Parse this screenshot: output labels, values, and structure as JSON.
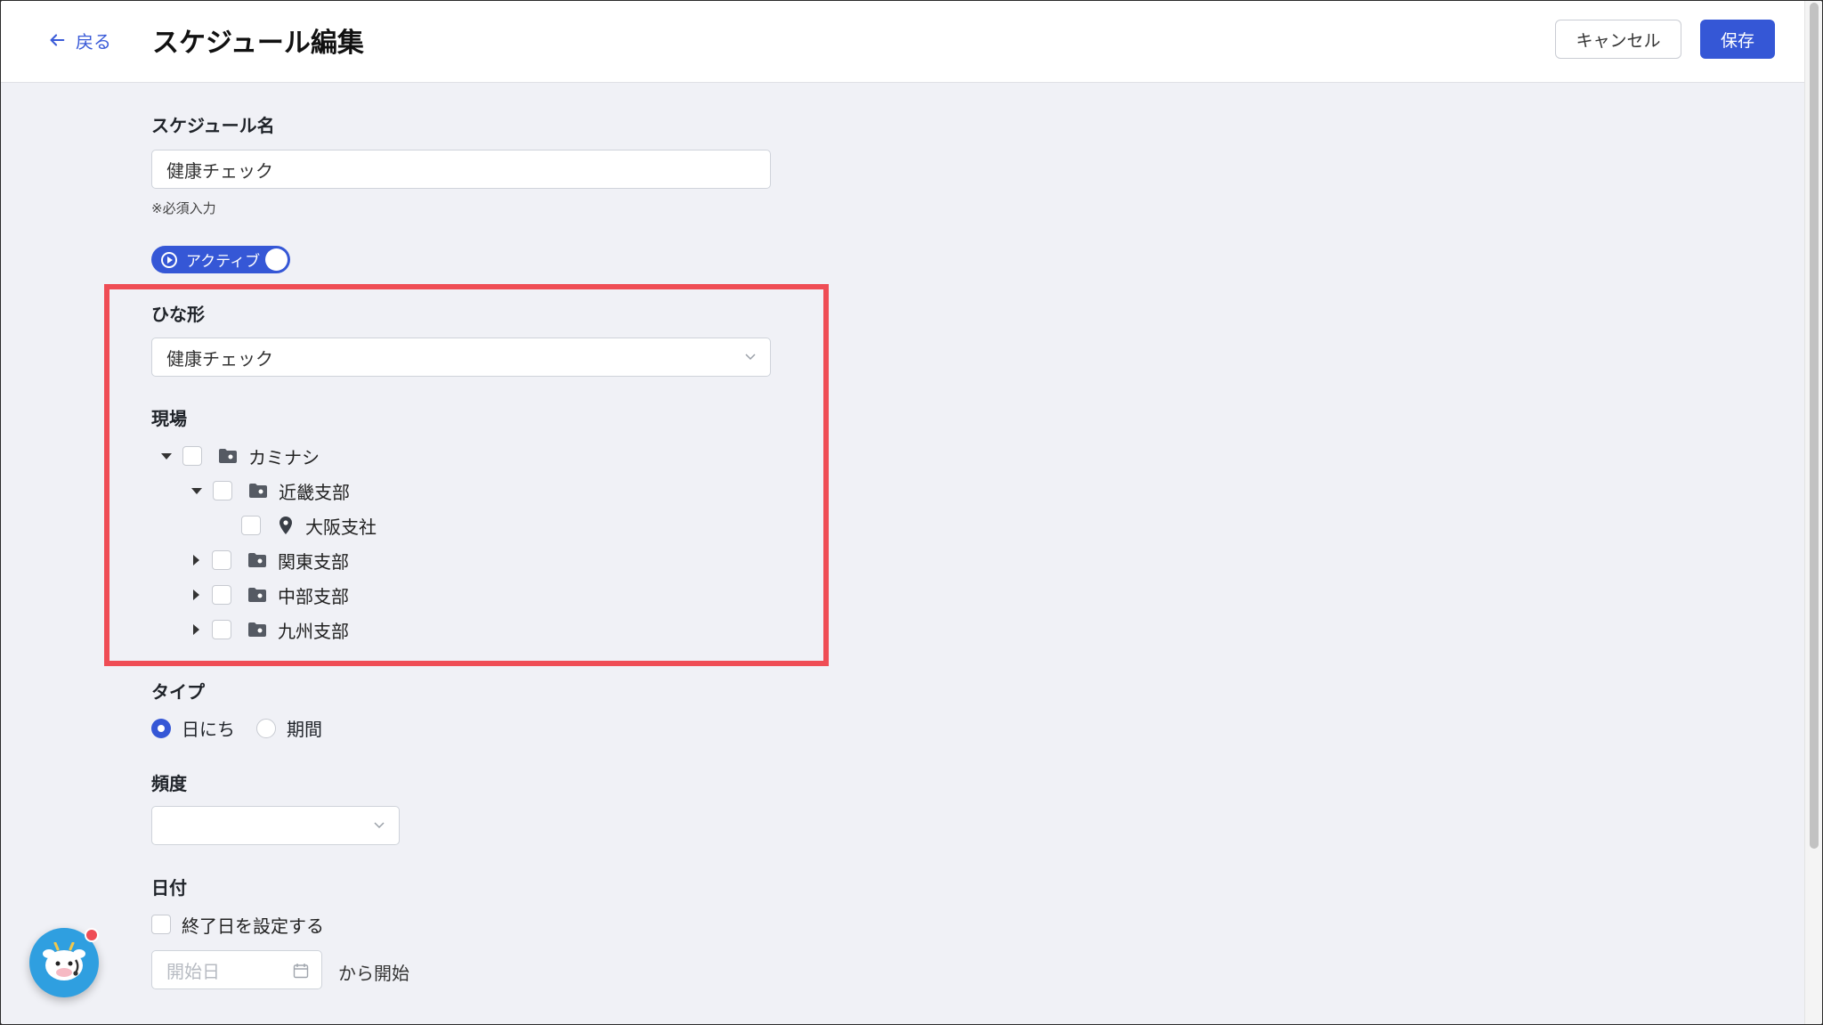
{
  "header": {
    "back_label": "戻る",
    "title": "スケジュール編集",
    "cancel_label": "キャンセル",
    "save_label": "保存"
  },
  "form": {
    "name_label": "スケジュール名",
    "name_value": "健康チェック",
    "required_hint": "※必須入力",
    "active_label": "アクティブ",
    "template_label": "ひな形",
    "template_value": "健康チェック",
    "site_label": "現場",
    "tree": [
      {
        "label": "カミナシ",
        "expanded": true,
        "icon": "folder-icon"
      },
      {
        "label": "近畿支部",
        "expanded": true,
        "icon": "folder-icon"
      },
      {
        "label": "大阪支社",
        "icon": "location-pin-icon"
      },
      {
        "label": "関東支部",
        "expanded": false,
        "icon": "folder-icon"
      },
      {
        "label": "中部支部",
        "expanded": false,
        "icon": "folder-icon"
      },
      {
        "label": "九州支部",
        "expanded": false,
        "icon": "folder-icon"
      }
    ],
    "type_label": "タイプ",
    "type_options": [
      "日にち",
      "期間"
    ],
    "type_selected": "日にち",
    "frequency_label": "頻度",
    "frequency_value": "",
    "date_label": "日付",
    "end_date_checkbox_label": "終了日を設定する",
    "start_date_placeholder": "開始日",
    "start_suffix": "から開始"
  },
  "colors": {
    "primary": "#3557d6",
    "highlight": "#ef4d55",
    "background": "#f0f1f6"
  }
}
